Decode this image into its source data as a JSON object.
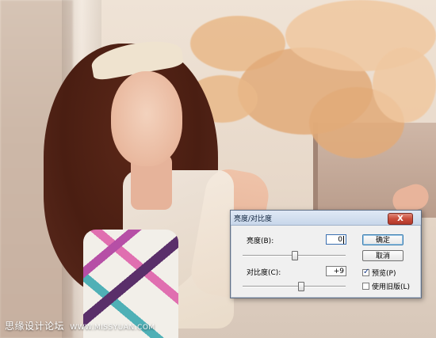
{
  "watermark": {
    "brand": "思缘设计论坛",
    "url": "WWW.MISSYUAN.COM"
  },
  "dialog": {
    "title": "亮度/对比度",
    "close_label": "X",
    "brightness": {
      "label": "亮度(B):",
      "value": "0",
      "slider_level": 0.5
    },
    "contrast": {
      "label": "对比度(C):",
      "value": "+9",
      "slider_level": 0.545
    },
    "buttons": {
      "ok": "确定",
      "cancel": "取消"
    },
    "options": {
      "preview": {
        "label": "预览(P)",
        "checked": true
      },
      "legacy": {
        "label": "使用旧版(L)",
        "checked": false
      }
    }
  }
}
